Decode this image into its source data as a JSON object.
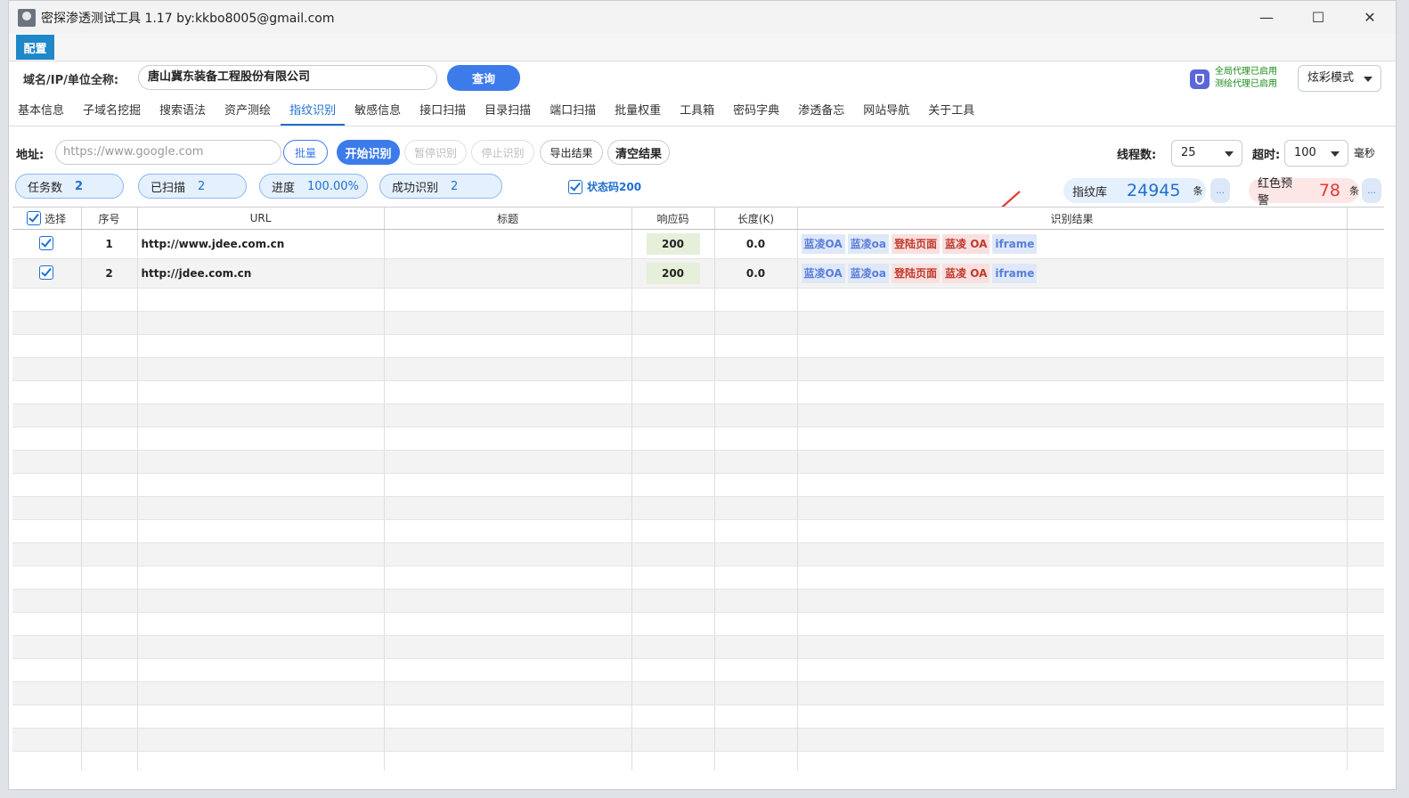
{
  "window": {
    "title": "密探渗透测试工具 1.17 by:kkbo8005@gmail.com",
    "minimize": "—",
    "maximize": "☐",
    "close": "✕"
  },
  "menu": {
    "config": "配置"
  },
  "domain_row": {
    "label": "域名/IP/单位全称:",
    "value": "唐山冀东装备工程股份有限公司",
    "query_button": "查询",
    "proxy_line1": "全局代理已启用",
    "proxy_line2": "测绘代理已启用",
    "mode": "炫彩模式"
  },
  "tabs": [
    "基本信息",
    "子域名挖掘",
    "搜索语法",
    "资产测绘",
    "指纹识别",
    "敏感信息",
    "接口扫描",
    "目录扫描",
    "端口扫描",
    "批量权重",
    "工具箱",
    "密码字典",
    "渗透备忘",
    "网站导航",
    "关于工具"
  ],
  "active_tab": "指纹识别",
  "toolbar": {
    "addr_label": "地址:",
    "addr_placeholder": "https://www.google.com",
    "batch": "批量",
    "start": "开始识别",
    "pause": "暂停识别",
    "stop": "停止识别",
    "export": "导出结果",
    "clear": "清空结果",
    "threads_label": "线程数:",
    "threads_value": "25",
    "timeout_label": "超时:",
    "timeout_value": "100",
    "timeout_unit": "毫秒"
  },
  "stats": {
    "tasks_label": "任务数",
    "tasks_value": "2",
    "scanned_label": "已扫描",
    "scanned_value": "2",
    "progress_label": "进度",
    "progress_value": "100.00%",
    "success_label": "成功识别",
    "success_value": "2",
    "status200": "状态码200",
    "fp_label": "指纹库",
    "fp_value": "24945",
    "fp_unit": "条",
    "red_label": "红色预警",
    "red_value": "78",
    "red_unit": "条",
    "more": "..."
  },
  "table": {
    "headers": [
      "选择",
      "序号",
      "URL",
      "标题",
      "响应码",
      "长度(K)",
      "识别结果"
    ],
    "rows": [
      {
        "index": "1",
        "url": "http://www.jdee.com.cn",
        "title": "",
        "code": "200",
        "length": "0.0",
        "tags": [
          {
            "text": "蓝凌OA",
            "color": "blue"
          },
          {
            "text": "蓝凌oa",
            "color": "blue"
          },
          {
            "text": "登陆页面",
            "color": "red"
          },
          {
            "text": "蓝凌 OA",
            "color": "red"
          },
          {
            "text": "iframe",
            "color": "blue"
          }
        ]
      },
      {
        "index": "2",
        "url": "http://jdee.com.cn",
        "title": "",
        "code": "200",
        "length": "0.0",
        "tags": [
          {
            "text": "蓝凌OA",
            "color": "blue"
          },
          {
            "text": "蓝凌oa",
            "color": "blue"
          },
          {
            "text": "登陆页面",
            "color": "red"
          },
          {
            "text": "蓝凌 OA",
            "color": "red"
          },
          {
            "text": "iframe",
            "color": "blue"
          }
        ]
      }
    ],
    "empty_rows": 21
  },
  "colors": {
    "accent": "#3d7bea",
    "annotation_arrow": "#e53935"
  }
}
